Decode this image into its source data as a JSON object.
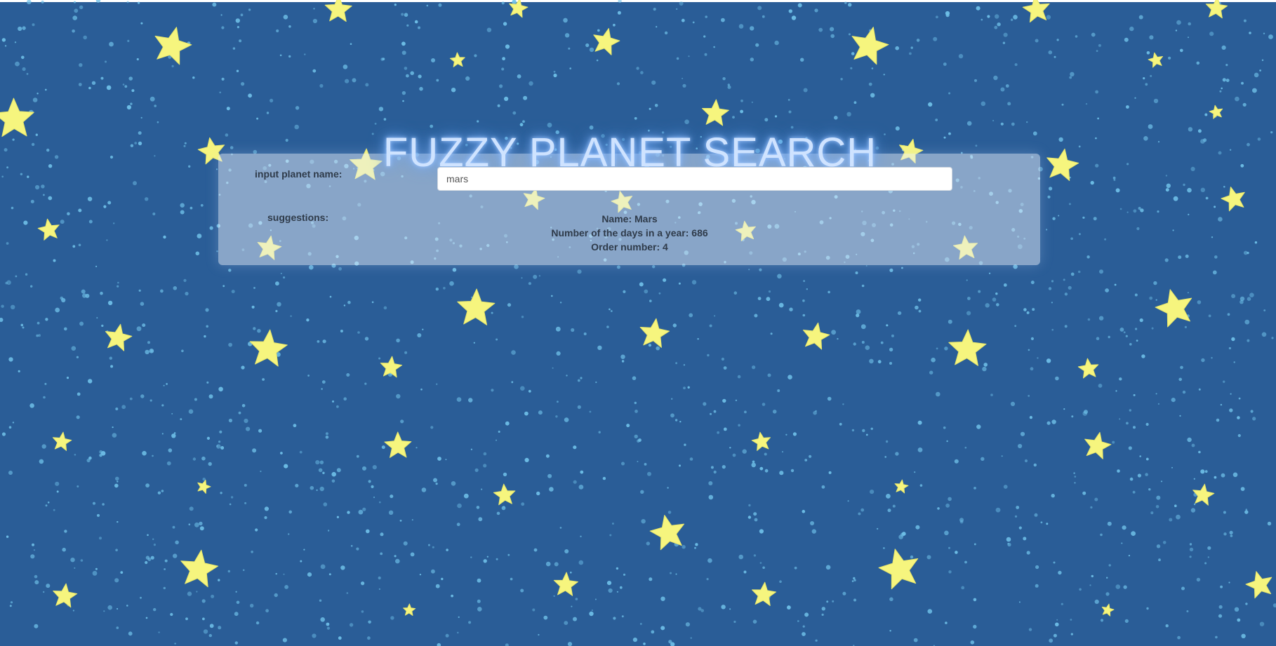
{
  "page": {
    "title": "FUZZY PLANET SEARCH",
    "background_color": "#2a5d97",
    "star_color": "#f6f57e",
    "dust_color": "#6fc0e8"
  },
  "search": {
    "label": "input planet name:",
    "value": "mars",
    "placeholder": ""
  },
  "suggestions": {
    "label": "suggestions:",
    "items": [
      {
        "name_line": "Name: Mars",
        "days_line": "Number of the days in a year: 686",
        "order_line": "Order number: 4"
      }
    ]
  },
  "decor": {
    "stars_icon": "star-icon",
    "dust_icon": "dot-icon"
  }
}
